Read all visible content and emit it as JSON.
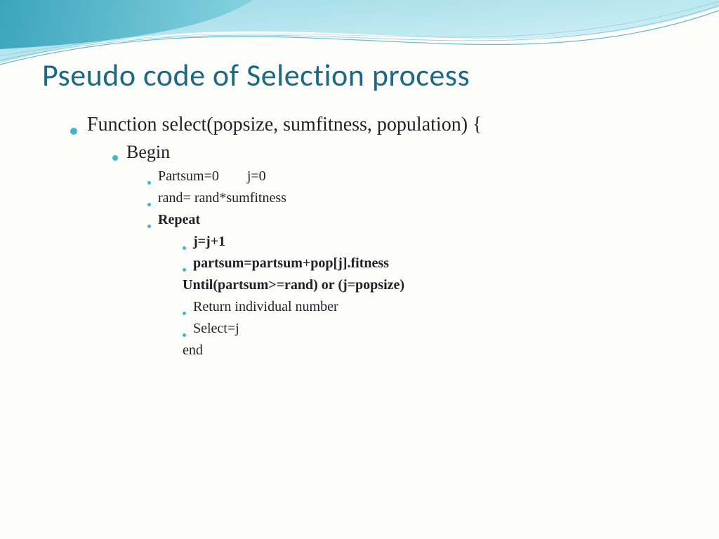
{
  "title": "Pseudo code of Selection process",
  "lines": {
    "l1": "Function select(popsize, sumfitness, population) {",
    "l2": "Begin",
    "l3": "Partsum=0  j=0",
    "l4": "rand= rand*sumfitness",
    "l5": "Repeat",
    "l6": "j=j+1",
    "l7": "partsum=partsum+pop[j].fitness",
    "l8": "Until(partsum>=rand) or (j=popsize)",
    "l9": "Return individual number",
    "l10": "Select=j",
    "l11": "end"
  }
}
